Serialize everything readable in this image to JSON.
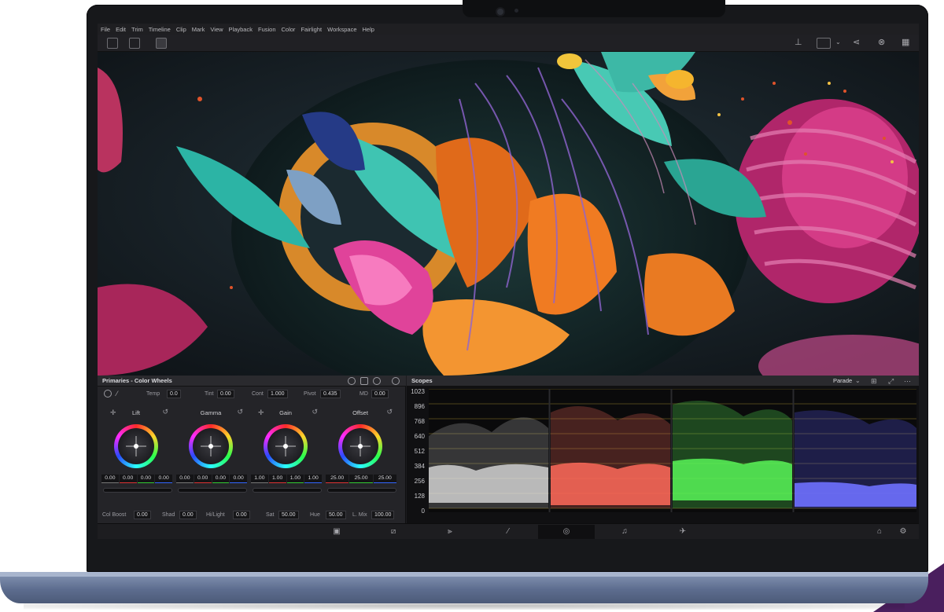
{
  "menu": [
    "File",
    "Edit",
    "Trim",
    "Timeline",
    "Clip",
    "Mark",
    "View",
    "Playback",
    "Fusion",
    "Color",
    "Fairlight",
    "Workspace",
    "Help"
  ],
  "color_panel": {
    "title": "Primaries - Color Wheels",
    "adjustments": [
      {
        "label": "Temp",
        "value": "0.0"
      },
      {
        "label": "Tint",
        "value": "0.00"
      },
      {
        "label": "Cont",
        "value": "1.000"
      },
      {
        "label": "Pivot",
        "value": "0.435"
      },
      {
        "label": "MD",
        "value": "0.00"
      }
    ],
    "wheels": [
      {
        "label": "Lift",
        "values": [
          "0.00",
          "0.00",
          "0.00",
          "0.00"
        ]
      },
      {
        "label": "Gamma",
        "values": [
          "0.00",
          "0.00",
          "0.00",
          "0.00"
        ]
      },
      {
        "label": "Gain",
        "values": [
          "1.00",
          "1.00",
          "1.00",
          "1.00"
        ]
      },
      {
        "label": "Offset",
        "values": [
          "25.00",
          "25.00",
          "25.00"
        ]
      }
    ],
    "bottom": [
      {
        "label": "Col Boost",
        "value": "0.00"
      },
      {
        "label": "Shad",
        "value": "0.00"
      },
      {
        "label": "Hi/Light",
        "value": "0.00"
      },
      {
        "label": "Sat",
        "value": "50.00"
      },
      {
        "label": "Hue",
        "value": "50.00"
      },
      {
        "label": "L. Mix",
        "value": "100.00"
      }
    ]
  },
  "scopes": {
    "title": "Scopes",
    "mode": "Parade",
    "axis": [
      "1023",
      "896",
      "768",
      "640",
      "512",
      "384",
      "256",
      "128",
      "0"
    ],
    "channel_colors": [
      "#d8d8d8",
      "#ff6a5a",
      "#5bff5b",
      "#5a5cff"
    ]
  },
  "icons": {
    "toolbar_left": [
      "media-pool-icon",
      "effects-icon",
      "clip-icon"
    ],
    "toolbar_right": [
      "audio-meter-icon",
      "viewer-mode-icon",
      "share-icon",
      "fx-icon",
      "grid-icon"
    ],
    "pages": [
      "media-page-icon",
      "cut-page-icon",
      "edit-page-icon",
      "fusion-page-icon",
      "color-page-icon",
      "fairlight-page-icon",
      "deliver-page-icon",
      "home-icon",
      "settings-icon"
    ]
  }
}
